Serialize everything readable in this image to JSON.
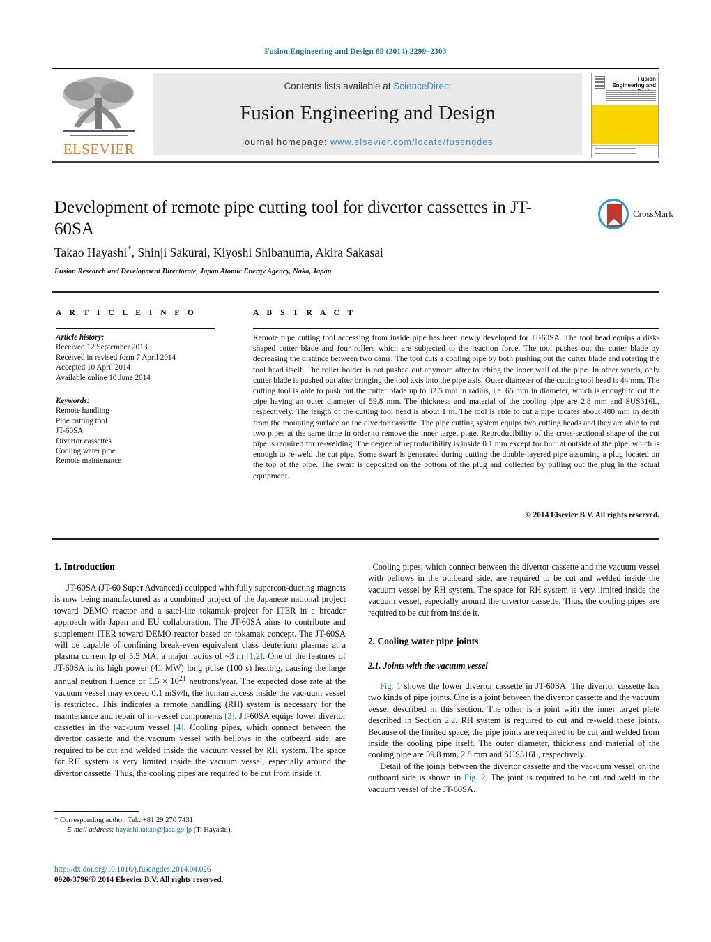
{
  "running_head": "Fusion Engineering and Design 89 (2014) 2299–2303",
  "masthead": {
    "contents_prefix": "Contents lists available at ",
    "sciencedirect": "ScienceDirect",
    "journal_title": "Fusion Engineering and Design",
    "homepage_prefix": "journal homepage: ",
    "homepage_url": "www.elsevier.com/locate/fusengdes",
    "publisher": "ELSEVIER",
    "cover_title": "Fusion Engineering and Design",
    "accent_link": "#3a8dc6",
    "cover_yellow": "#fbd500",
    "elsevier_orange": "#e87722"
  },
  "crossmark": {
    "label": "CrossMark"
  },
  "article": {
    "title": "Development of remote pipe cutting tool for divertor cassettes in JT-60SA",
    "authors": "Takao Hayashi",
    "authors_rest": ", Shinji Sakurai, Kiyoshi Shibanuma, Akira Sakasai",
    "corresponding_marker": "*",
    "affiliation": "Fusion Research and Development Directorate, Japan Atomic Energy Agency, Naka, Japan"
  },
  "labels": {
    "article_info": "A R T I C L E   I N F O",
    "abstract": "A B S T R A C T"
  },
  "article_info": {
    "history_header": "Article history:",
    "history": [
      "Received 12 September 2013",
      "Received in revised form 7 April 2014",
      "Accepted 10 April 2014",
      "Available online 10 June 2014"
    ],
    "keywords_header": "Keywords:",
    "keywords": [
      "Remote handling",
      "Pipe cutting tool",
      "JT-60SA",
      "Divertor cassettes",
      "Cooling water pipe",
      "Remote maintenance"
    ]
  },
  "abstract_text": "Remote pipe cutting tool accessing from inside pipe has been newly developed for JT-60SA. The tool head equips a disk-shaped cutter blade and four rollers which are subjected to the reaction force. The tool pushes out the cutter blade by decreasing the distance between two cams. The tool cuts a cooling pipe by both pushing out the cutter blade and rotating the tool head itself. The roller holder is not pushed out anymore after touching the inner wall of the pipe. In other words, only cutter blade is pushed out after bringing the tool axis into the pipe axis. Outer diameter of the cutting tool head is 44 mm. The cutting tool is able to push out the cutter blade up to 32.5 mm in radius, i.e. 65 mm in diameter, which is enough to cut the pipe having an outer diameter of 59.8 mm. The thickness and material of the cooling pipe are 2.8 mm and SUS316L, respectively. The length of the cutting tool head is about 1 m. The tool is able to cut a pipe locates about 480 mm in depth from the mounting surface on the divertor cassette. The pipe cutting system equips two cutting heads and they are able to cut two pipes at the same time in order to remove the inner target plate. Reproducibility of the cross-sectional shape of the cut pipe is required for re-welding. The degree of reproducibility is inside 0.1 mm except for burr at outside of the pipe, which is enough to re-weld the cut pipe. Some swarf is generated during cutting the double-layered pipe assuming a plug located on the top of the pipe. The swarf is deposited on the bottom of the plug and collected by pulling out the plug in the actual equipment.",
  "copyright": "© 2014  Elsevier B.V. All rights reserved.",
  "sections": {
    "intro_heading": "1.  Introduction",
    "intro_p1_a": "JT-60SA (JT-60 Super Advanced) equipped with fully supercon-ducting magnets is now being manufactured as a combined project of the Japanese national project toward DEMO reactor and a satel-lite tokamak project for ITER in a broader approach with Japan and EU collaboration. The JT-60SA aims to contribute and supplement ITER toward DEMO reactor based on tokamak concept. The JT-60SA will be capable of confining break-even equivalent class deuterium plasmas at a plasma current Ip of 5.5 MA, a major radius of ~3 m ",
    "ref_12": "[1,2]",
    "intro_p1_b": ". One of the features of JT-60SA is its high power (41 MW) long pulse (100 s) heating, causing the large annual neutron fluence of 1.5 × 10",
    "exp_21": "21",
    "intro_p1_c": " neutrons/year. The expected dose rate at the vacuum vessel may exceed 0.1 mSv/h, the human access inside the vac-uum vessel is restricted. This indicates a remote handling (RH) system is necessary for the maintenance and repair of in-vessel components ",
    "ref_3": "[3]",
    "intro_p1_d": ". JT-60SA equips lower divertor cassettes in the vac-uum vessel ",
    "ref_4": "[4]",
    "intro_p1_e": ". Cooling pipes, which connect between the divertor cassette and the vacuum vessel with bellows in the outbeard side, are required to be cut and welded inside the vacuum vessel by RH system. The space for RH system is very limited inside the vacuum vessel, especially around the divertor cassette. Thus, the cooling pipes are required to be cut from inside it.",
    "sec2_heading": "2.  Cooling water pipe joints",
    "sec21_heading": "2.1.  Joints with the vacuum vessel",
    "sec21_p1_fig": "Fig. 1",
    "sec21_p1_a": " shows the lower divertor cassette in JT-60SA. The divertor cassette has two kinds of pipe joints. One is a joint between the divertor cassette and the vacuum vessel described in this section. The other is a joint with the inner target plate described in Section ",
    "sec21_ref_22": "2.2",
    "sec21_p1_b": ". RH system is required to cut and re-weld these joints. Because of the limited space, the pipe joints are required to be cut and welded from inside the cooling pipe itself. The outer diameter, thickness and material of the cooling pipe are 59.8 mm, 2.8 mm and SUS316L, respectively.",
    "sec21_p2_a": "Detail of the joints between the divertor cassette and the vac-uum vessel on the outboard side is shown in ",
    "sec21_p2_fig": "Fig. 2",
    "sec21_p2_b": ". The joint is required to be cut and weld in the vacuum vessel of the JT-60SA."
  },
  "footnote": {
    "star": "*",
    "corresponding": " Corresponding author. Tel.: +81 29 270 7431.",
    "email_label": "E-mail address:",
    "email": "hayashi.takao@jaea.go.jp",
    "email_suffix": " (T. Hayashi)."
  },
  "doi": {
    "url": "http://dx.doi.org/10.1016/j.fusengdes.2014.04.026",
    "issn_line": "0920-3796/© 2014 Elsevier B.V. All rights reserved."
  }
}
